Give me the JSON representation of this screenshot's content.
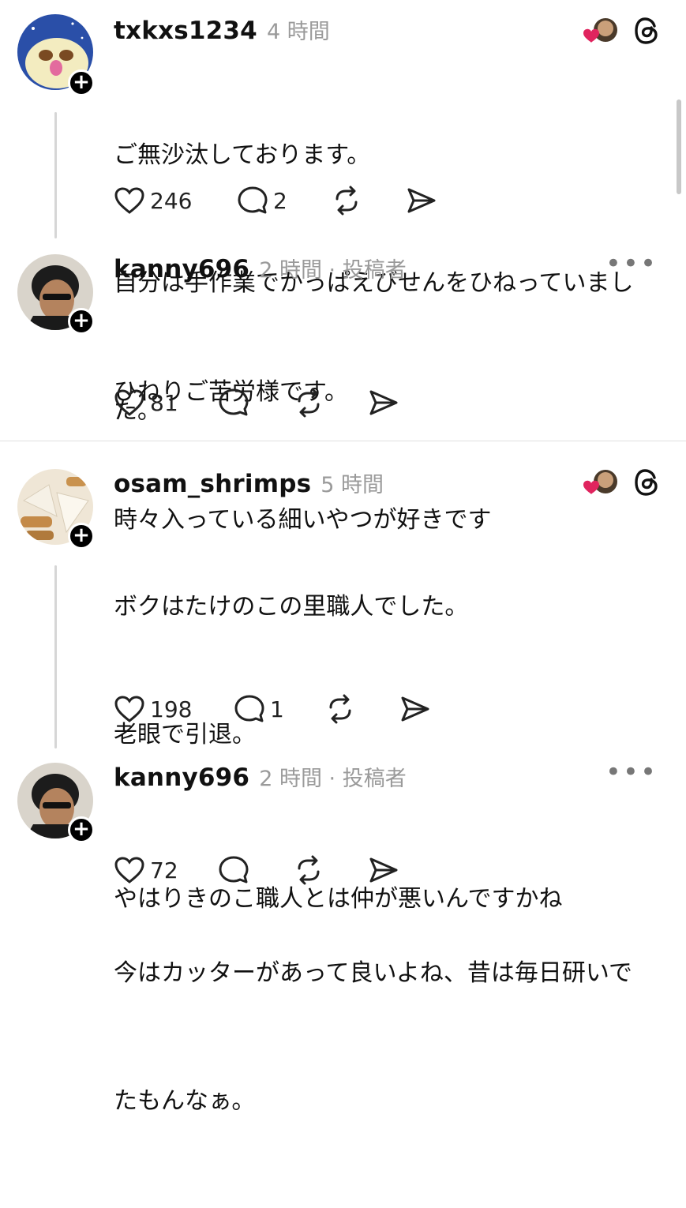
{
  "posts": [
    {
      "username": "txkxs1234",
      "time": "4 時間",
      "lines": [
        "ご無沙汰しております。",
        "自分は手作業でかっぱえびせんをひねっていまし",
        "た。"
      ],
      "likes": "246",
      "replies": "2"
    },
    {
      "username": "kanny696",
      "time": "2 時間 · 投稿者",
      "lines": [
        "ひねりご苦労様です。",
        "時々入っている細いやつが好きです"
      ],
      "likes": "81",
      "replies": ""
    },
    {
      "username": "osam_shrimps",
      "time": "5 時間",
      "lines": [
        "ボクはたけのこの里職人でした。",
        "老眼で引退。",
        "",
        "今はカッターがあって良いよね、昔は毎日研いで",
        "たもんなぁ。"
      ],
      "likes": "198",
      "replies": "1"
    },
    {
      "username": "kanny696",
      "time": "2 時間 · 投稿者",
      "lines": [
        "やはりきのこ職人とは仲が悪いんですかね"
      ],
      "likes": "72",
      "replies": ""
    }
  ],
  "icons": {
    "like": "heart-outline-icon",
    "reply": "speech-bubble-icon",
    "repost": "repost-arrows-icon",
    "share": "send-icon",
    "threads": "threads-logo-icon",
    "liked_by_author": "heart-with-avatar-icon",
    "follow": "plus-icon",
    "more": "more-dots-icon"
  },
  "colors": {
    "heart_red": "#e0245e",
    "muted": "#9a9a9a"
  }
}
